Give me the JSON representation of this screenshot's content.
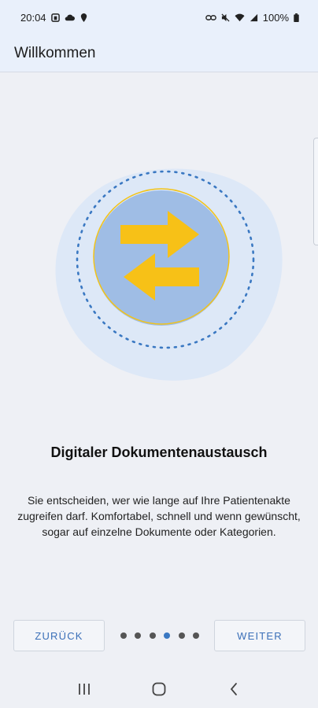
{
  "status_bar": {
    "time": "20:04",
    "battery_text": "100%",
    "left_icons": [
      "clock-app-icon",
      "cloud-icon",
      "location-pin-icon"
    ],
    "right_icons": [
      "link-icon",
      "mute-icon",
      "wifi-icon",
      "signal-icon",
      "battery-icon"
    ]
  },
  "app_bar": {
    "title": "Willkommen"
  },
  "illustration": {
    "icon": "document-exchange-arrows-icon",
    "colors": {
      "blob": "#dde8f7",
      "circle": "#9fbde5",
      "ring": "#f2c318",
      "dotted_ring": "#3a78c2",
      "arrows": "#f7c117"
    }
  },
  "onboarding": {
    "headline": "Digitaler Dokumentenaustausch",
    "description": "Sie entscheiden, wer wie lange auf Ihre Patientenakte zugreifen darf. Komfortabel, schnell und wenn gewünscht, sogar auf einzelne Dokumente oder Kategorien."
  },
  "pager": {
    "total_pages": 6,
    "current_page": 4
  },
  "buttons": {
    "back_label": "ZURÜCK",
    "next_label": "WEITER"
  },
  "nav_bar": {
    "icons": [
      "recent-apps-icon",
      "home-icon",
      "back-icon"
    ]
  },
  "colors": {
    "accent": "#3a78c2",
    "app_bar_bg": "#e9f0fb",
    "page_bg": "#eef0f5"
  }
}
